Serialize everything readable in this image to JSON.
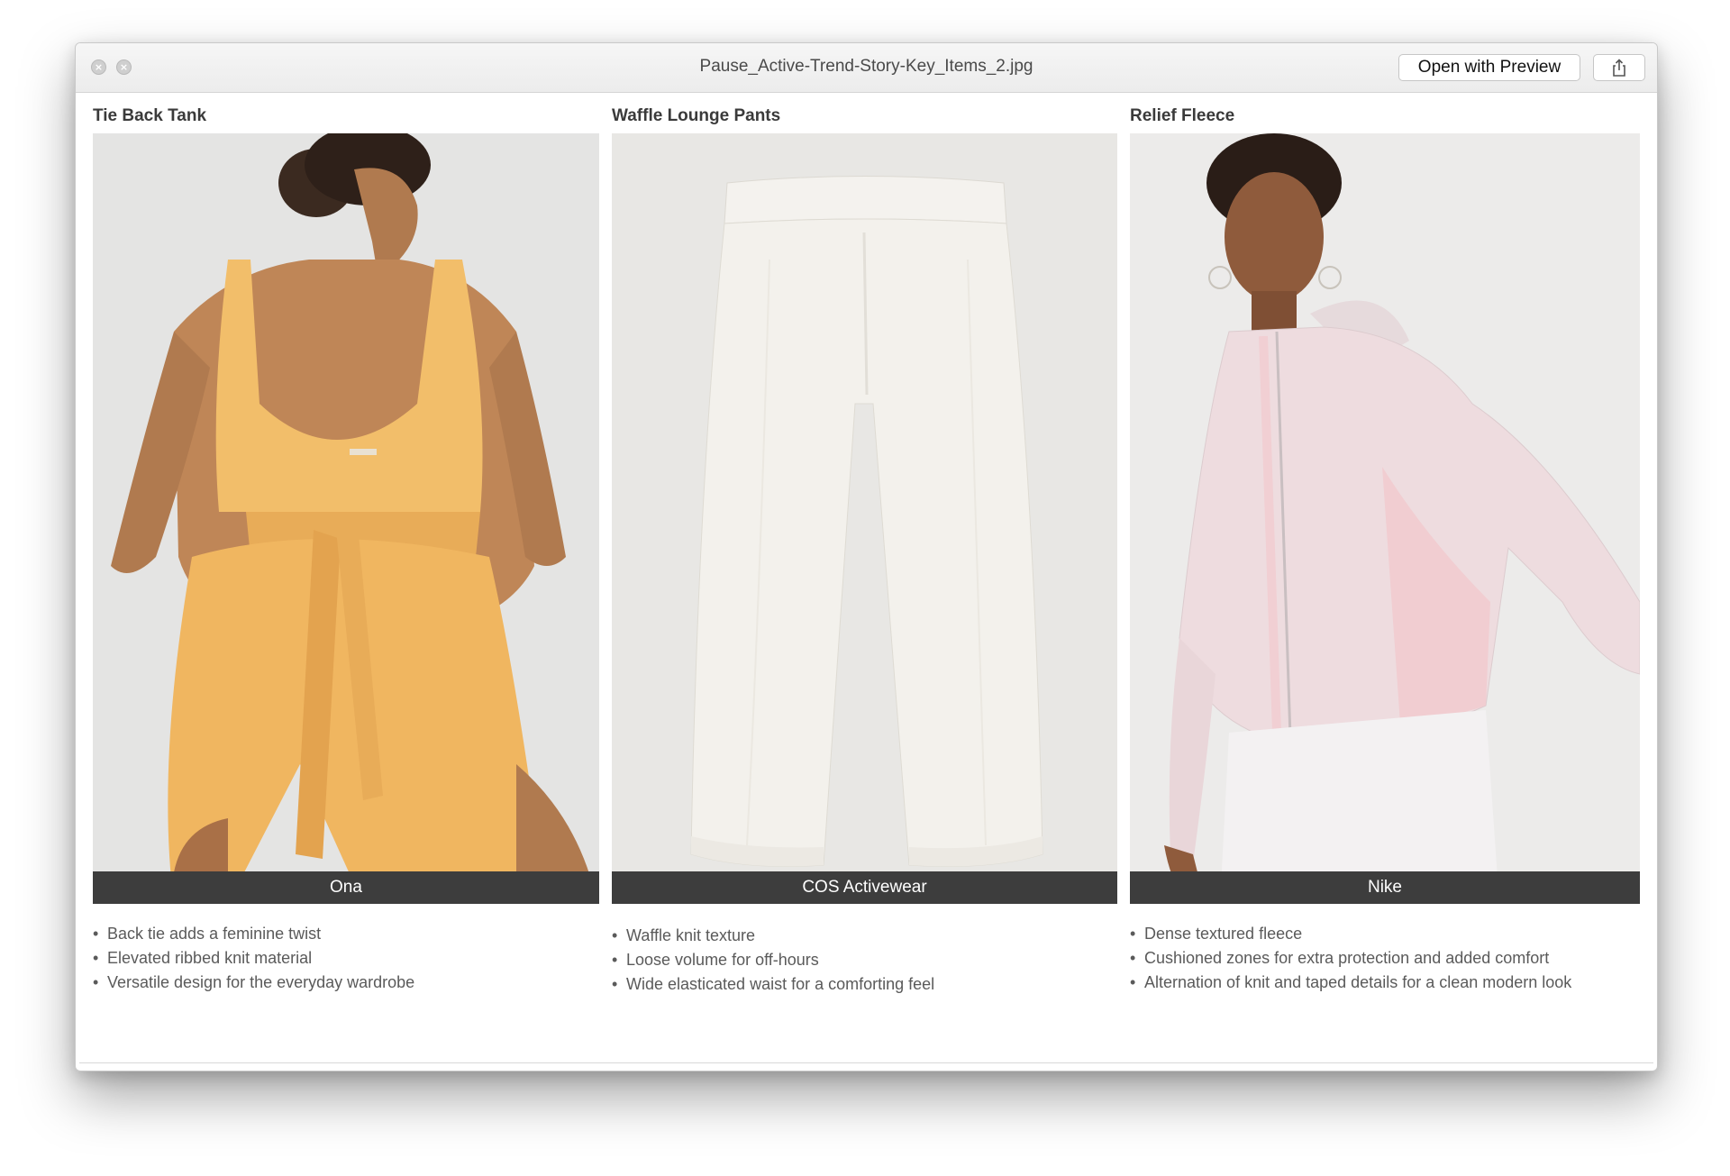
{
  "window": {
    "title": "Pause_Active-Trend-Story-Key_Items_2.jpg",
    "open_button_label": "Open with Preview",
    "close_glyph": "×",
    "minimize_glyph": "×",
    "icons": {
      "close": "close-icon",
      "minimize": "minimize-icon",
      "share": "share-icon"
    }
  },
  "products": [
    {
      "title": "Tie Back Tank",
      "brand": "Ona",
      "bullets": [
        "Back tie adds a feminine twist",
        "Elevated ribbed knit material",
        "Versatile design for the everyday wardrobe"
      ],
      "photo_color": "#f2be6a"
    },
    {
      "title": "Waffle Lounge Pants",
      "brand": "COS Activewear",
      "bullets": [
        "Waffle knit texture",
        "Loose volume for off-hours",
        "Wide elasticated waist for a comforting feel"
      ],
      "photo_color": "#f1efe9"
    },
    {
      "title": "Relief Fleece",
      "brand": "Nike",
      "bullets": [
        "Dense textured fleece",
        "Cushioned zones for extra protection and added comfort",
        " Alternation of knit and taped details for a clean modern look"
      ],
      "photo_color": "#eeddde"
    }
  ]
}
